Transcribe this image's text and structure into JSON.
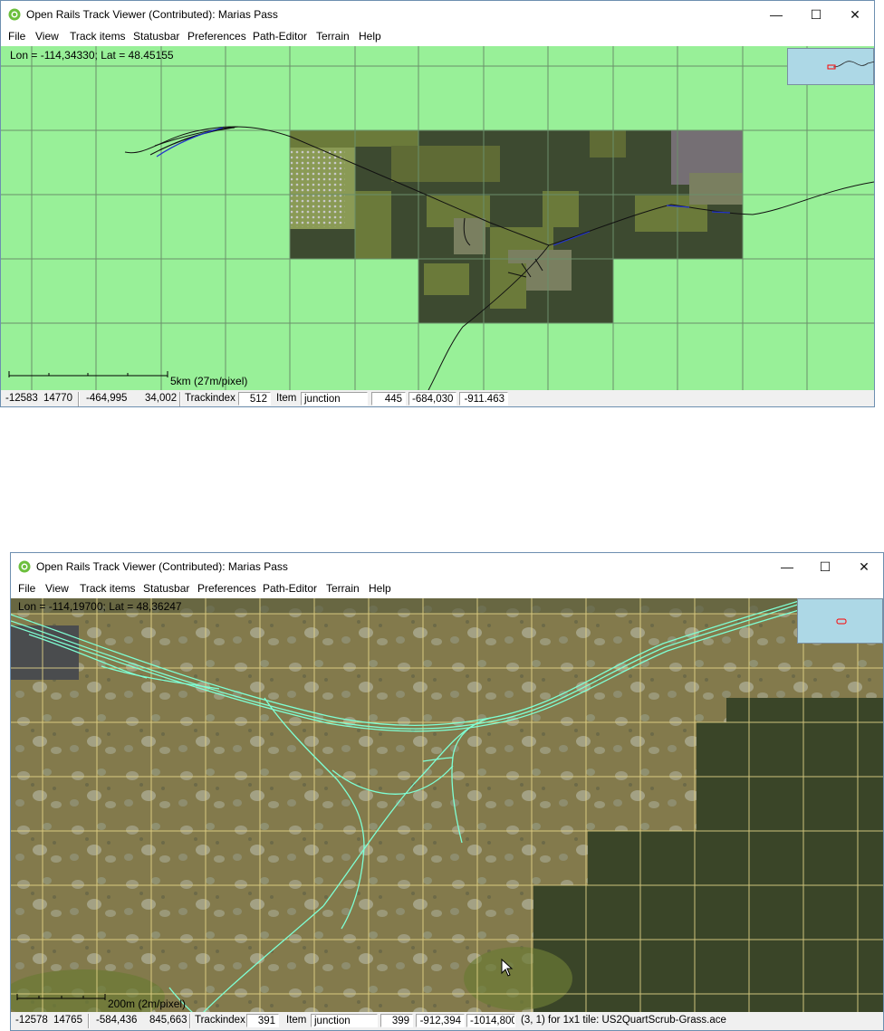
{
  "colors": {
    "window_border": "#6d8fb0",
    "grass_background": "#98f098",
    "grid_line": "#6a8f6a",
    "terrain_dark": "#3d4a30",
    "terrain_mid": "#5f6b35",
    "terrain_light": "#8a9a55",
    "texture_grid_line": "#e8d88a",
    "track_cyan": "#7fffd4",
    "minimap_bg": "#add8e6",
    "minimap_marker": "#ff0000"
  },
  "window1": {
    "title": "Open Rails Track Viewer (Contributed): Marias Pass",
    "controls": {
      "minimize": "—",
      "maximize": "☐",
      "close": "✕"
    },
    "menu": [
      "File",
      "View",
      "Track items",
      "Statusbar",
      "Preferences",
      "Path-Editor",
      "Terrain",
      "Help"
    ],
    "coords": "Lon = -114,34330; Lat = 48.45155",
    "scale_label": "5km (27m/pixel)",
    "status": {
      "tile_x": "-12583",
      "tile_z": "14770",
      "loc_x": "-464,995",
      "loc_z": "34,002",
      "trackindex_label": "Trackindex",
      "trackindex": "512",
      "item_label": "Item",
      "item": "junction",
      "item_index": "445",
      "item_x": "-684,030",
      "item_z": "-911.463"
    }
  },
  "window2": {
    "title": "Open Rails Track Viewer (Contributed): Marias Pass",
    "controls": {
      "minimize": "—",
      "maximize": "☐",
      "close": "✕"
    },
    "menu": [
      "File",
      "View",
      "Track items",
      "Statusbar",
      "Preferences",
      "Path-Editor",
      "Terrain",
      "Help"
    ],
    "coords": "Lon = -114,19700; Lat = 48,36247",
    "scale_label": "200m (2m/pixel)",
    "status": {
      "tile_x": "-12578",
      "tile_z": "14765",
      "loc_x": "-584,436",
      "loc_z": "845,663",
      "trackindex_label": "Trackindex",
      "trackindex": "391",
      "item_label": "Item",
      "item": "junction",
      "item_index": "399",
      "item_x": "-912,394",
      "item_z": "-1014,800",
      "terrain_info": "(3, 1) for 1x1 tile: US2QuartScrub-Grass.ace"
    }
  }
}
